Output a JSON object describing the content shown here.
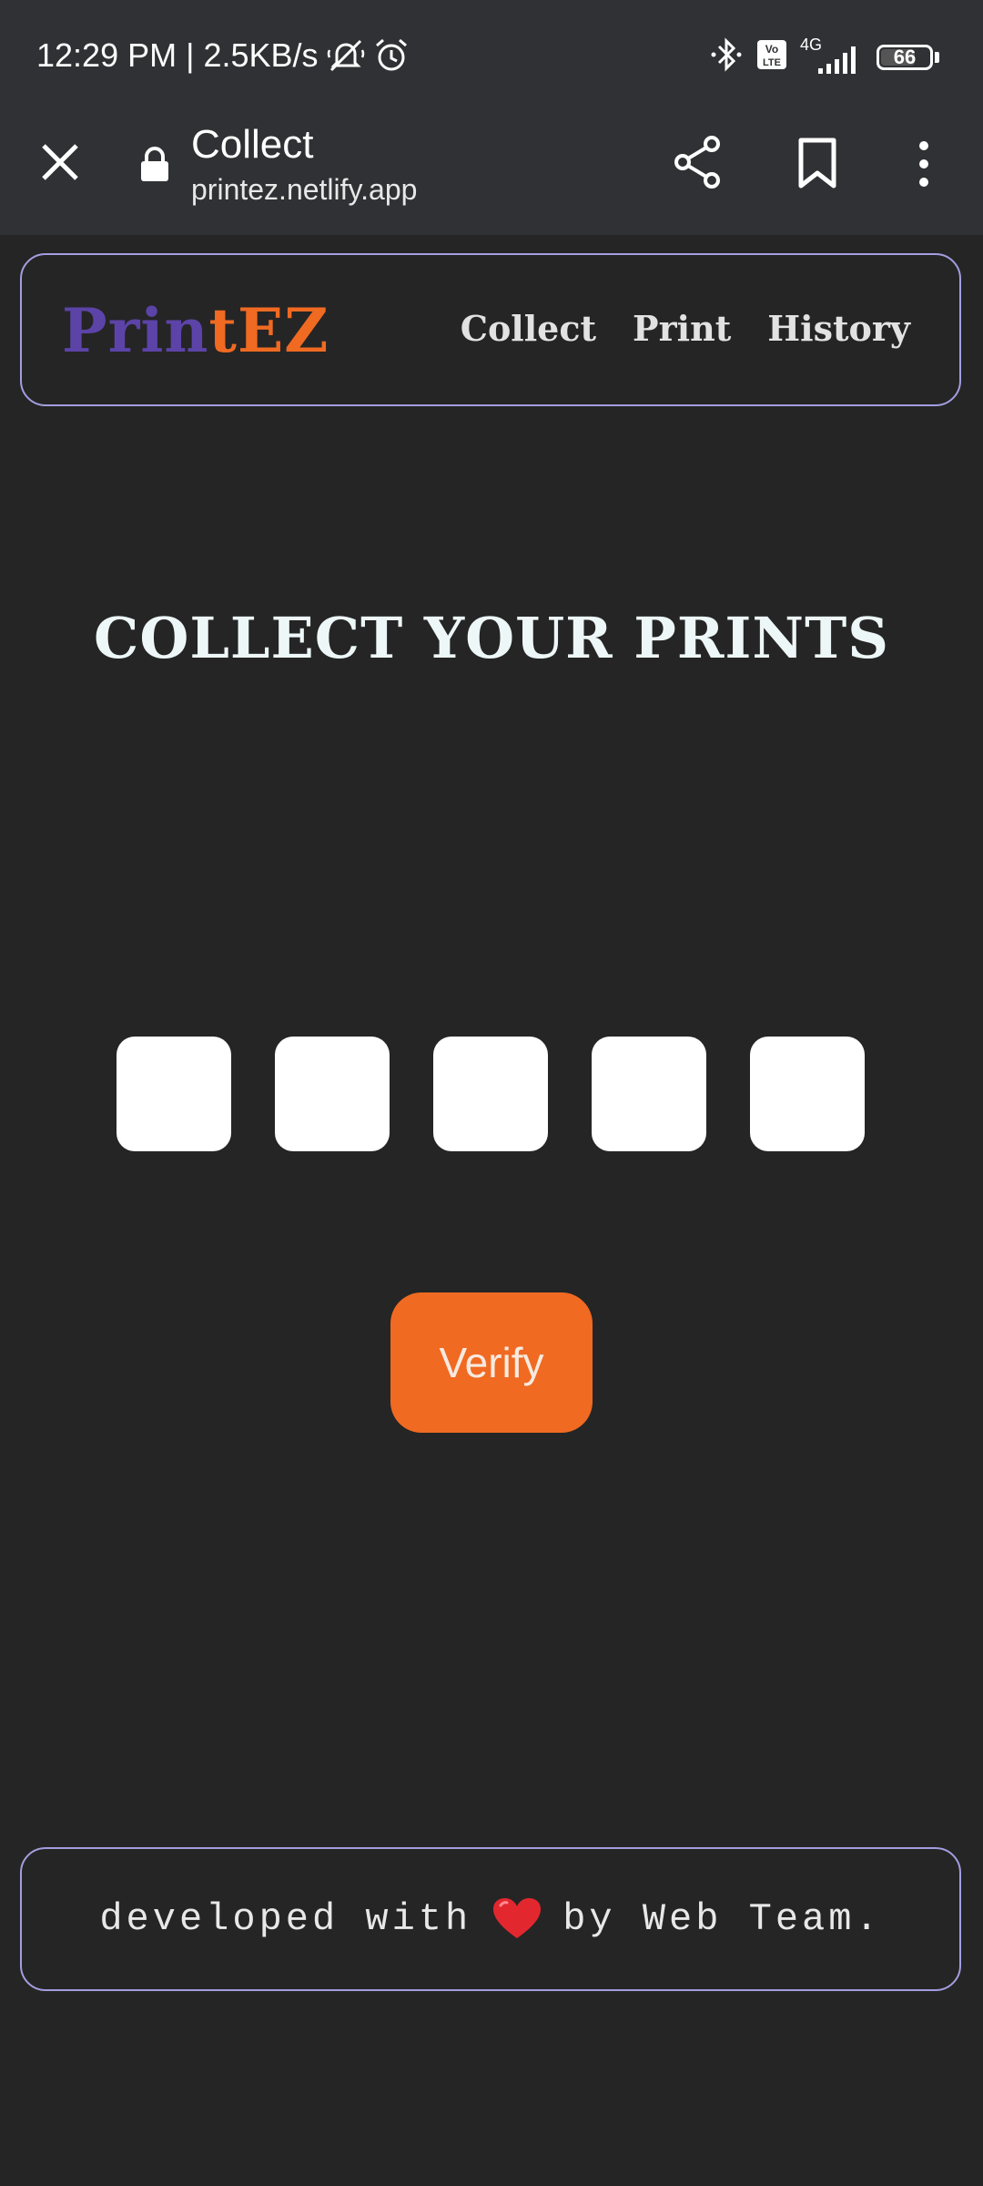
{
  "status_bar": {
    "time_speed": "12:29 PM | 2.5KB/s",
    "network_label": "4G",
    "volte_label": "Vo LTE",
    "battery": "66",
    "icons": [
      "mute-bell-icon",
      "alarm-icon",
      "bluetooth-icon",
      "volte-icon",
      "signal-icon",
      "battery-icon"
    ]
  },
  "browser": {
    "page_title": "Collect",
    "url": "printez.netlify.app",
    "icons": [
      "close-icon",
      "lock-icon",
      "share-icon",
      "bookmark-icon",
      "more-icon"
    ]
  },
  "navbar": {
    "logo_part1": "Prin",
    "logo_part2": "tEZ",
    "links": [
      "Collect",
      "Print",
      "History"
    ]
  },
  "main": {
    "heading": "COLLECT YOUR PRINTS",
    "code_inputs": [
      "",
      "",
      "",
      "",
      ""
    ],
    "verify_label": "Verify"
  },
  "footer": {
    "text_before": "developed with",
    "text_after": "by Web Team."
  },
  "colors": {
    "background": "#252525",
    "bars": "#303134",
    "accent_orange": "#f06a22",
    "logo_purple": "#5c43a8",
    "border_lavender": "#a39ee0"
  }
}
